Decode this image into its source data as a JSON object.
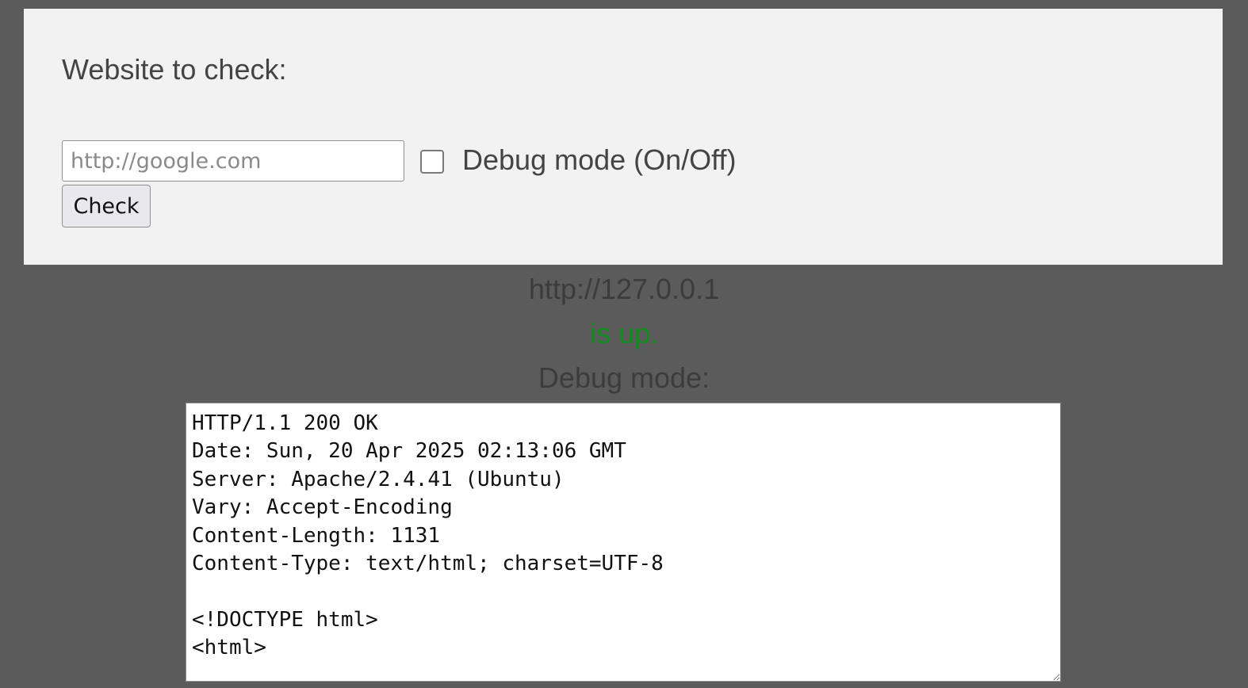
{
  "form": {
    "label": "Website to check:",
    "url_input": {
      "value": "",
      "placeholder": "http://google.com"
    },
    "debug_checkbox": {
      "label": "Debug mode (On/Off)",
      "checked": false
    },
    "check_button_label": "Check"
  },
  "result": {
    "url": "http://127.0.0.1",
    "status": "is up.",
    "debug_label": "Debug mode:",
    "debug_output": "HTTP/1.1 200 OK\nDate: Sun, 20 Apr 2025 02:13:06 GMT\nServer: Apache/2.4.41 (Ubuntu)\nVary: Accept-Encoding\nContent-Length: 1131\nContent-Type: text/html; charset=UTF-8\n\n<!DOCTYPE html>\n<html>"
  },
  "colors": {
    "page_background": "#5b5b5b",
    "panel_background": "#f2f2f2",
    "status_up": "#0f8c1c"
  }
}
